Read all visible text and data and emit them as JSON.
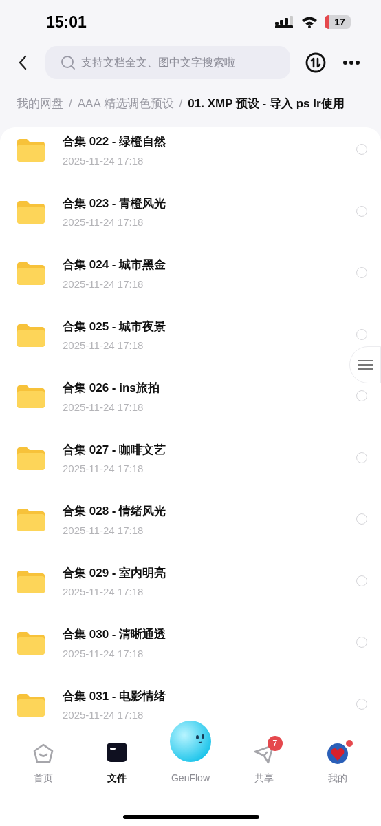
{
  "status_bar": {
    "time": "15:01",
    "battery": "17"
  },
  "header": {
    "search": {
      "placeholder": "支持文档全文、图中文字搜索啦"
    }
  },
  "breadcrumb": [
    {
      "label": "我的网盘",
      "selected": false
    },
    {
      "separator": "/",
      "label": "AAA 精选调色预设",
      "selected": false
    },
    {
      "separator": "/",
      "label": "01. XMP 预设 - 导入 ps lr使用",
      "selected": true
    }
  ],
  "files": [
    {
      "name": "合集 022 - 绿橙自然",
      "date": "2025-11-24 17:18",
      "selected": false
    },
    {
      "name": "合集 023 - 青橙风光",
      "date": "2025-11-24 17:18",
      "selected": false
    },
    {
      "name": "合集 024 - 城市黑金",
      "date": "2025-11-24 17:18",
      "selected": false
    },
    {
      "name": "合集 025 - 城市夜景",
      "date": "2025-11-24 17:18",
      "selected": false
    },
    {
      "name": "合集 026 - ins旅拍",
      "date": "2025-11-24 17:18",
      "selected": false
    },
    {
      "name": "合集 027 - 咖啡文艺",
      "date": "2025-11-24 17:18",
      "selected": false
    },
    {
      "name": "合集 028 - 情绪风光",
      "date": "2025-11-24 17:18",
      "selected": false
    },
    {
      "name": "合集 029 - 室内明亮",
      "date": "2025-11-24 17:18",
      "selected": false
    },
    {
      "name": "合集 030 - 清晰通透",
      "date": "2025-11-24 17:18",
      "selected": false
    },
    {
      "name": "合集 031 - 电影情绪",
      "date": "2025-11-24 17:18",
      "selected": false
    }
  ],
  "tab_bar": [
    {
      "kind": "home",
      "label": "首页",
      "selected": false
    },
    {
      "kind": "files",
      "label": "文件",
      "selected": true
    },
    {
      "kind": "genflow",
      "label": "GenFlow",
      "selected": false
    },
    {
      "kind": "share",
      "label": "共享",
      "selected": false,
      "badge": "7"
    },
    {
      "kind": "me",
      "label": "我的",
      "selected": false
    }
  ]
}
